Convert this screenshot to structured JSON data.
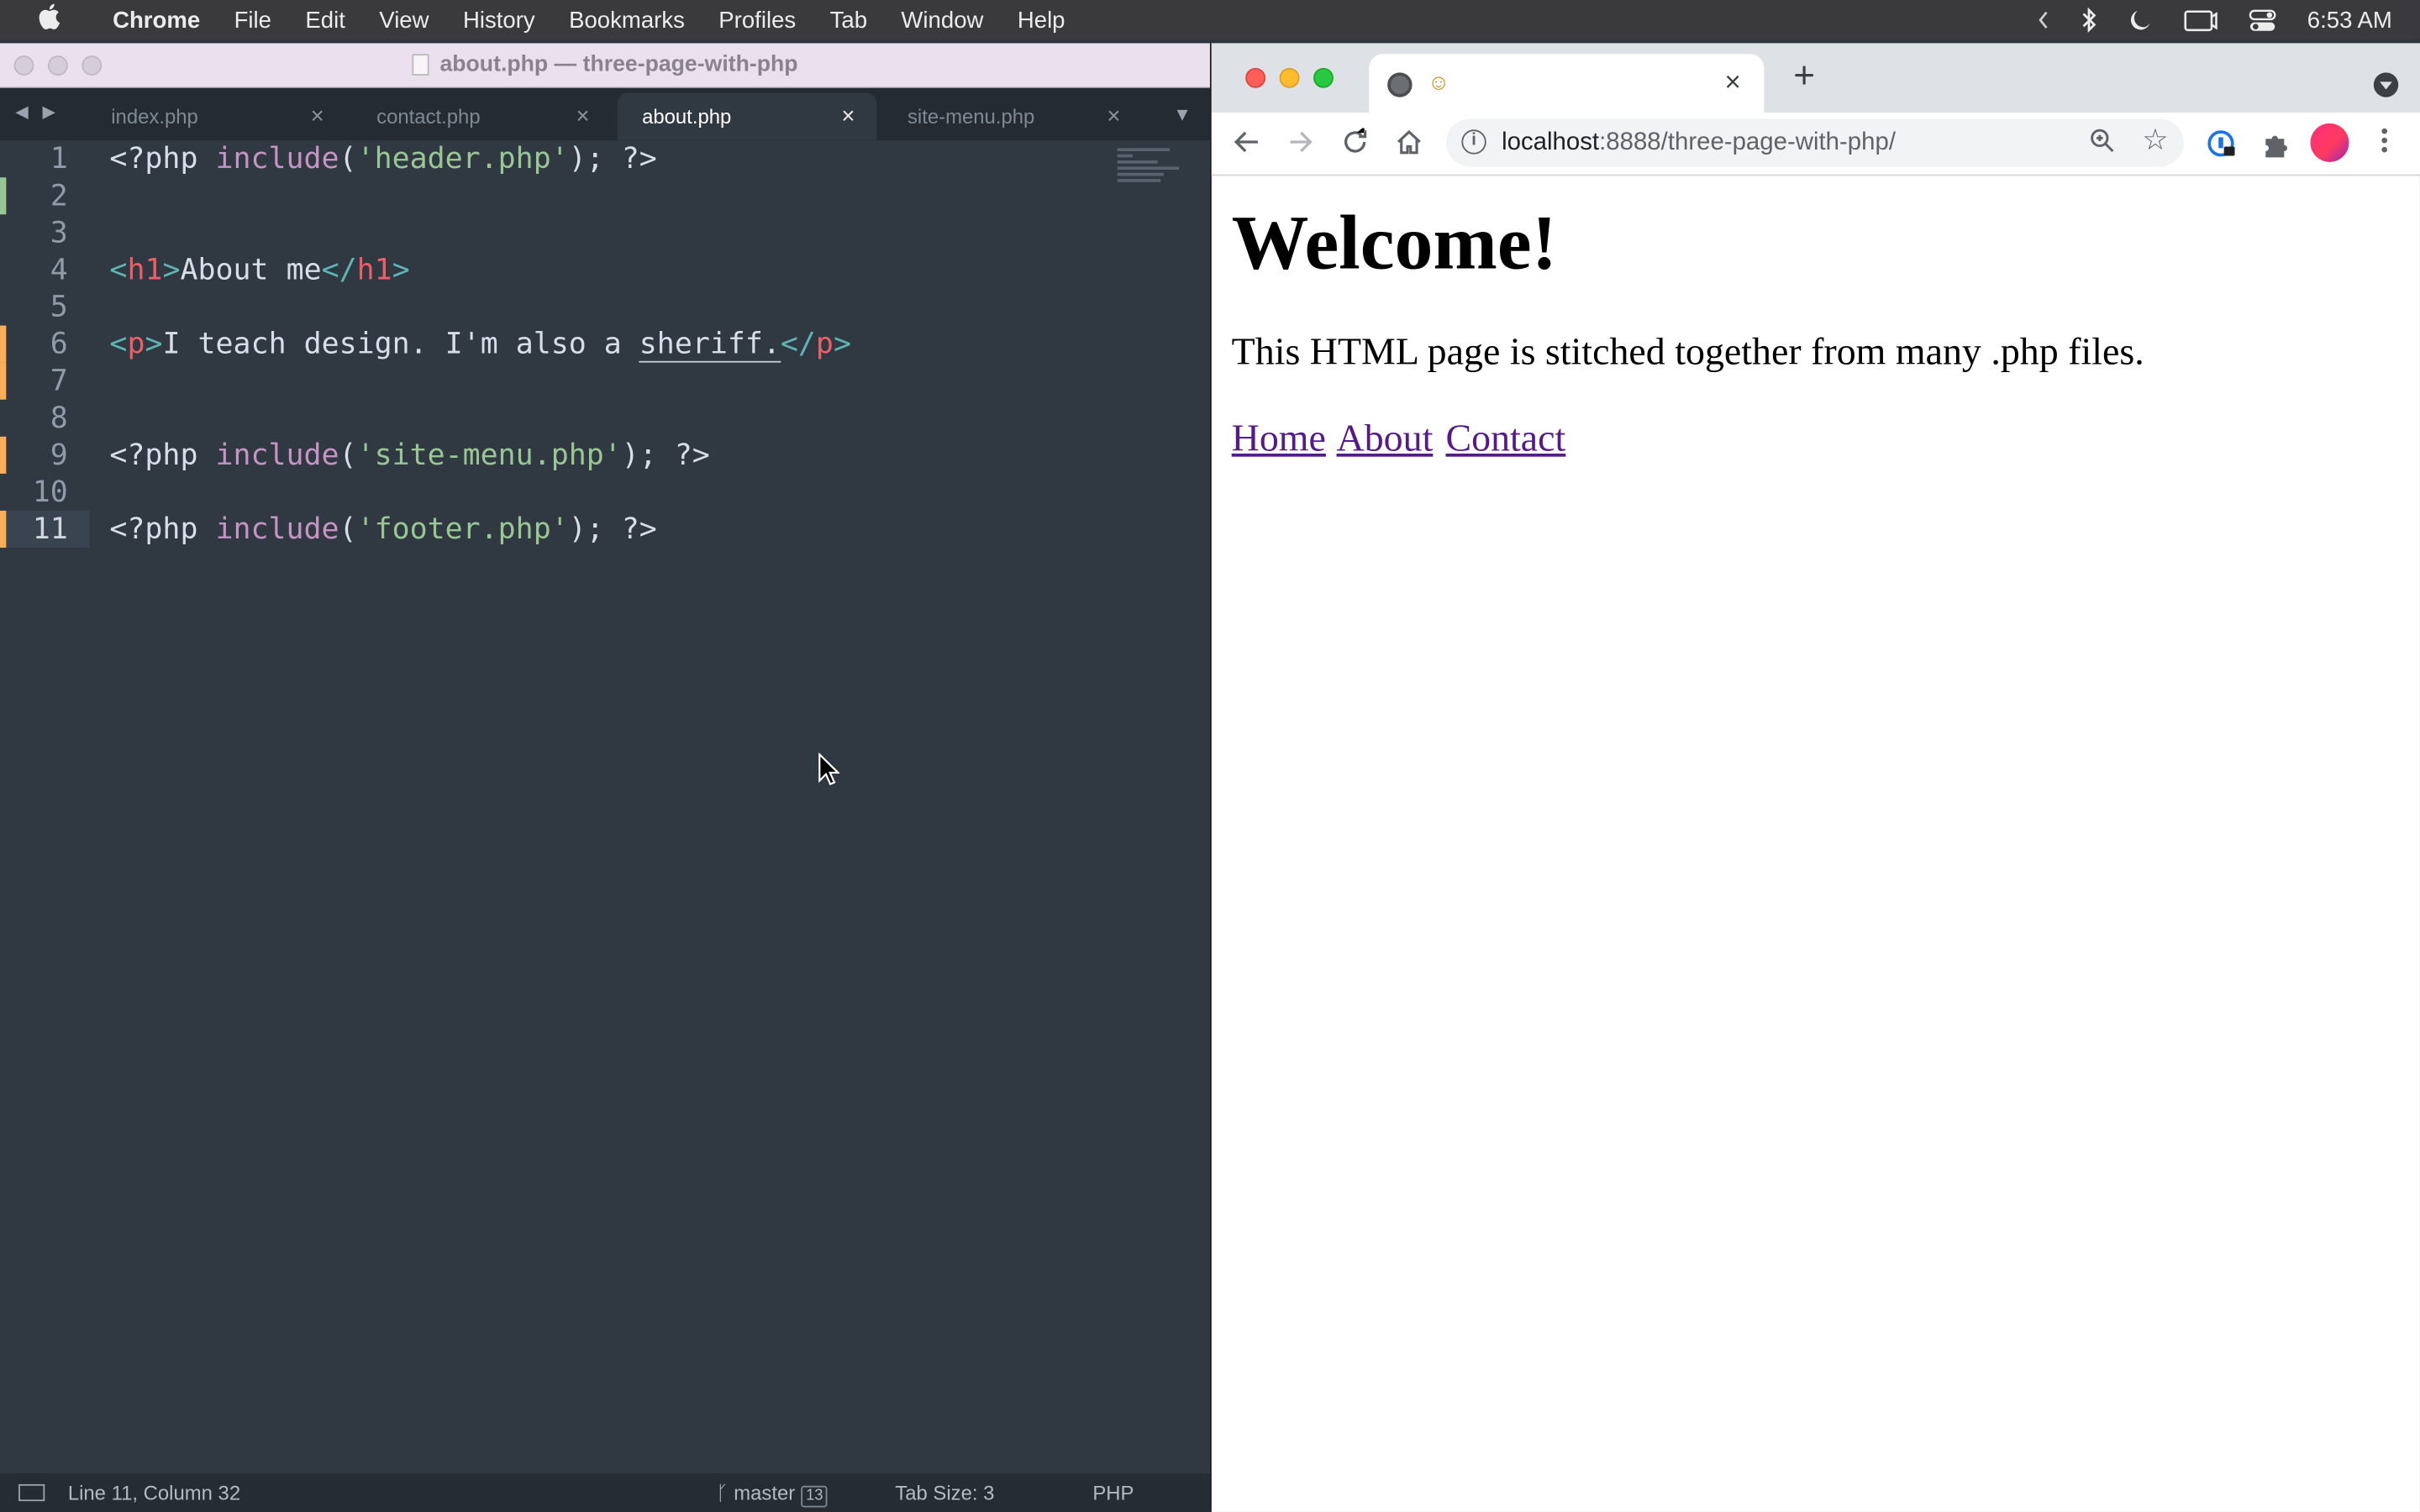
{
  "menubar": {
    "app": "Chrome",
    "items": [
      "File",
      "Edit",
      "View",
      "History",
      "Bookmarks",
      "Profiles",
      "Tab",
      "Window",
      "Help"
    ],
    "clock": "6:53 AM"
  },
  "editor": {
    "title": "about.php — three-page-with-php",
    "tabs": [
      {
        "label": "index.php"
      },
      {
        "label": "contact.php"
      },
      {
        "label": "about.php",
        "active": true
      },
      {
        "label": "site-menu.php"
      }
    ],
    "close_glyph": "×",
    "lines": [
      {
        "num": "1",
        "marker": "",
        "tokens": [
          [
            "plain",
            "<?php "
          ],
          [
            "kw",
            "include"
          ],
          [
            "plain",
            "("
          ],
          [
            "str",
            "'header.php'"
          ],
          [
            "plain",
            "); ?>"
          ]
        ]
      },
      {
        "num": "2",
        "marker": "add",
        "tokens": []
      },
      {
        "num": "3",
        "marker": "",
        "tokens": []
      },
      {
        "num": "4",
        "marker": "",
        "tokens": [
          [
            "br",
            "<"
          ],
          [
            "tag",
            "h1"
          ],
          [
            "br",
            ">"
          ],
          [
            "plain",
            "About me"
          ],
          [
            "br",
            "</"
          ],
          [
            "tag",
            "h1"
          ],
          [
            "br",
            ">"
          ]
        ]
      },
      {
        "num": "5",
        "marker": "",
        "tokens": []
      },
      {
        "num": "6",
        "marker": "mod",
        "tokens": [
          [
            "br",
            "<"
          ],
          [
            "tag",
            "p"
          ],
          [
            "br",
            ">"
          ],
          [
            "plain",
            "I teach design. I'm also a "
          ],
          [
            "ul",
            "sheriff."
          ],
          [
            "br",
            "</"
          ],
          [
            "tag",
            "p"
          ],
          [
            "br",
            ">"
          ]
        ]
      },
      {
        "num": "7",
        "marker": "mod",
        "tokens": []
      },
      {
        "num": "8",
        "marker": "",
        "tokens": []
      },
      {
        "num": "9",
        "marker": "mod",
        "tokens": [
          [
            "plain",
            "<?php "
          ],
          [
            "kw",
            "include"
          ],
          [
            "plain",
            "("
          ],
          [
            "str",
            "'site-menu.php'"
          ],
          [
            "plain",
            "); ?>"
          ]
        ]
      },
      {
        "num": "10",
        "marker": "",
        "tokens": []
      },
      {
        "num": "11",
        "marker": "mod",
        "current": true,
        "tokens": [
          [
            "plain",
            "<?php "
          ],
          [
            "kw",
            "include"
          ],
          [
            "plain",
            "("
          ],
          [
            "str",
            "'footer.php'"
          ],
          [
            "plain",
            "); ?>"
          ]
        ]
      }
    ],
    "status": {
      "position": "Line 11, Column 32",
      "branch": "master",
      "branch_count": "13",
      "tab_size": "Tab Size: 3",
      "syntax": "PHP"
    },
    "colors": {
      "background": "#303841",
      "keyword": "#c594c5",
      "string": "#99c794",
      "tag": "#ec5f67",
      "bracket": "#5fb4b4"
    }
  },
  "browser": {
    "tab_close": "×",
    "new_tab": "+",
    "url_host": "localhost",
    "url_rest": ":8888/three-page-with-php/",
    "page": {
      "heading": "Welcome!",
      "paragraph": "This HTML page is stitched together from many .php files.",
      "links": [
        "Home",
        "About",
        "Contact"
      ]
    },
    "link_color": "#551a8b"
  }
}
